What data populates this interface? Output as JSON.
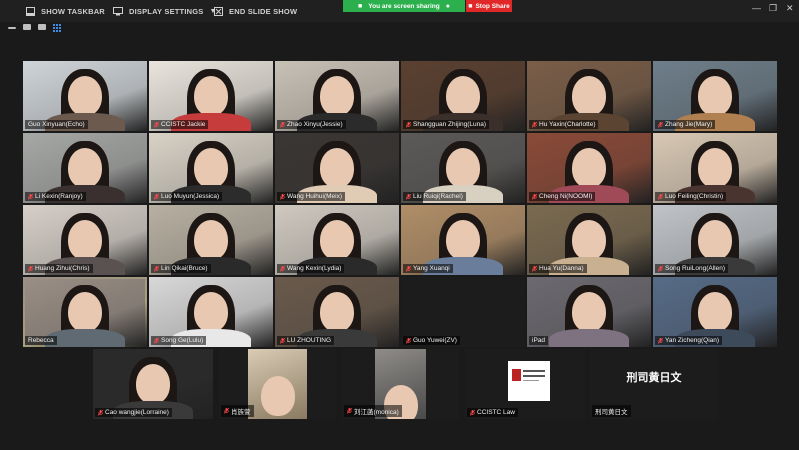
{
  "toolbar": {
    "show_taskbar": "SHOW TASKBAR",
    "display_settings": "DISPLAY SETTINGS",
    "end_slide_show": "END SLIDE SHOW",
    "sharing_notice": "You are screen sharing",
    "stop_share": "Stop Share"
  },
  "colors": {
    "sharing_green": "#2bb04d",
    "stop_red": "#e02828",
    "active_speaker": "#e2e05a",
    "grid_icon_blue": "#3c8ce8"
  },
  "participants": [
    {
      "name": "Guo Xinyuan(Echo)",
      "muted": false
    },
    {
      "name": "CCISTC Jackie",
      "muted": true
    },
    {
      "name": "Zhao Xinyu(Jessie)",
      "muted": true
    },
    {
      "name": "Shangguan Zhijing(Luna)",
      "muted": true
    },
    {
      "name": "Hu Yaxin(Charlotte)",
      "muted": true
    },
    {
      "name": "Zhang Jie(Mary)",
      "muted": true
    },
    {
      "name": "Li Kexin(Ranjoy)",
      "muted": true
    },
    {
      "name": "Luo Muyun(Jessica)",
      "muted": true
    },
    {
      "name": "Wang Huihui(Meix)",
      "muted": true
    },
    {
      "name": "Liu Ruiqi(Rachel)",
      "muted": true
    },
    {
      "name": "Cheng Ni(NOOMI)",
      "muted": true
    },
    {
      "name": "Luo Feiling(Christin)",
      "muted": true
    },
    {
      "name": "Huang Zihui(Chris)",
      "muted": true
    },
    {
      "name": "Lin Qikai(Bruce)",
      "muted": true
    },
    {
      "name": "Wang Kexin(Lydia)",
      "muted": true
    },
    {
      "name": "Yang Xuanqi",
      "muted": true
    },
    {
      "name": "Hua Yu(Danna)",
      "muted": true
    },
    {
      "name": "Song RuiLong(Allen)",
      "muted": true
    },
    {
      "name": "Rebecca",
      "muted": false
    },
    {
      "name": "Song Ge(Lulu)",
      "muted": true
    },
    {
      "name": "LU ZHOUTING",
      "muted": true
    },
    {
      "name": "Guo Yuwei(ZV)",
      "muted": true
    },
    {
      "name": "iPad",
      "muted": false
    },
    {
      "name": "Yan Zicheng(Qian)",
      "muted": true
    },
    {
      "name": "Cao wangjie(Lorraine)",
      "muted": true
    },
    {
      "name": "肖族萱",
      "muted": true
    },
    {
      "name": "刘江菡(monica)",
      "muted": true
    },
    {
      "name": "CCISTC Law",
      "muted": true
    },
    {
      "name": "刑司黄日文",
      "muted": false
    }
  ],
  "placeholder_name": "刑司黄日文"
}
